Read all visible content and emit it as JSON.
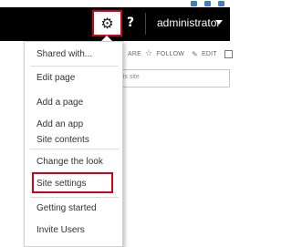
{
  "suite_bar": {
    "settings_icon": "gear-icon",
    "help_label": "?",
    "user_name": "administrator",
    "highlight_color": "#d0021b"
  },
  "ribbon": {
    "share_label": "ARE",
    "follow_label": "FOLLOW",
    "edit_label": "EDIT"
  },
  "search": {
    "placeholder": "this site"
  },
  "settings_menu": {
    "items": [
      {
        "label": "Shared with..."
      },
      {
        "label": "Edit page"
      },
      {
        "label": "Add a page"
      },
      {
        "label": "Add an app"
      },
      {
        "label": "Site contents"
      },
      {
        "label": "Change the look"
      },
      {
        "label": "Site settings",
        "highlighted": true
      },
      {
        "label": "Getting started"
      },
      {
        "label": "Invite Users"
      }
    ]
  }
}
